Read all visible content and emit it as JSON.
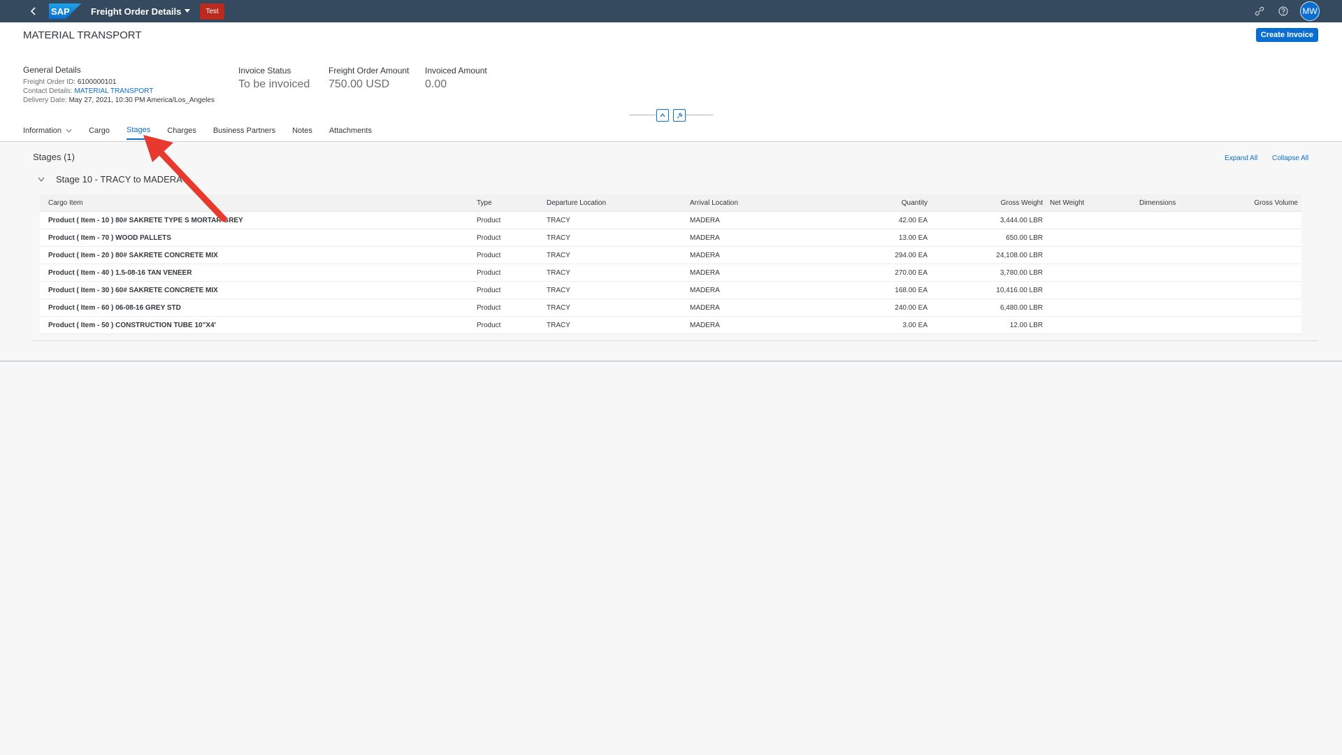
{
  "shell": {
    "app_title": "Freight Order Details",
    "env_badge": "Test",
    "logo_text": "SAP",
    "avatar_initials": "MW"
  },
  "header": {
    "title": "MATERIAL TRANSPORT",
    "create_invoice_label": "Create Invoice",
    "general": {
      "title": "General Details",
      "freight_order_id_label": "Freight Order ID:",
      "freight_order_id": "6100000101",
      "contact_label": "Contact Details:",
      "contact_value": "MATERIAL TRANSPORT",
      "delivery_label": "Delivery Date:",
      "delivery_value": "May 27, 2021, 10:30 PM America/Los_Angeles"
    },
    "kpis": [
      {
        "label": "Invoice Status",
        "value": "To be invoiced"
      },
      {
        "label": "Freight Order Amount",
        "value": "750.00 USD"
      },
      {
        "label": "Invoiced Amount",
        "value": "0.00"
      }
    ]
  },
  "tabs": [
    {
      "label": "Information"
    },
    {
      "label": "Cargo"
    },
    {
      "label": "Stages"
    },
    {
      "label": "Charges"
    },
    {
      "label": "Business Partners"
    },
    {
      "label": "Notes"
    },
    {
      "label": "Attachments"
    }
  ],
  "section": {
    "title": "Stages (1)",
    "expand_all": "Expand All",
    "collapse_all": "Collapse All",
    "stage_title": "Stage 10 - TRACY to MADERA"
  },
  "table": {
    "columns": [
      "Cargo Item",
      "Type",
      "Departure Location",
      "Arrival Location",
      "Quantity",
      "Gross Weight",
      "Net Weight",
      "Dimensions",
      "Gross Volume"
    ],
    "rows": [
      {
        "item": "Product ( Item - 10 ) 80# SAKRETE TYPE S MORTAR GREY",
        "type": "Product",
        "dep": "TRACY",
        "arr": "MADERA",
        "qty": "42.00 EA",
        "gw": "3,444.00 LBR"
      },
      {
        "item": "Product ( Item - 70 ) WOOD PALLETS",
        "type": "Product",
        "dep": "TRACY",
        "arr": "MADERA",
        "qty": "13.00 EA",
        "gw": "650.00 LBR"
      },
      {
        "item": "Product ( Item - 20 ) 80# SAKRETE CONCRETE MIX",
        "type": "Product",
        "dep": "TRACY",
        "arr": "MADERA",
        "qty": "294.00 EA",
        "gw": "24,108.00 LBR"
      },
      {
        "item": "Product ( Item - 40 ) 1.5-08-16 TAN VENEER",
        "type": "Product",
        "dep": "TRACY",
        "arr": "MADERA",
        "qty": "270.00 EA",
        "gw": "3,780.00 LBR"
      },
      {
        "item": "Product ( Item - 30 ) 60# SAKRETE CONCRETE MIX",
        "type": "Product",
        "dep": "TRACY",
        "arr": "MADERA",
        "qty": "168.00 EA",
        "gw": "10,416.00 LBR"
      },
      {
        "item": "Product ( Item - 60 ) 06-08-16 GREY STD",
        "type": "Product",
        "dep": "TRACY",
        "arr": "MADERA",
        "qty": "240.00 EA",
        "gw": "6,480.00 LBR"
      },
      {
        "item": "Product ( Item - 50 ) CONSTRUCTION TUBE 10\"X4'",
        "type": "Product",
        "dep": "TRACY",
        "arr": "MADERA",
        "qty": "3.00 EA",
        "gw": "12.00 LBR"
      }
    ]
  },
  "colors": {
    "shell_bg": "#354a5f",
    "accent": "#0a6ed1",
    "badge_red": "#bb2a1f",
    "annotation_arrow": "#e8392f"
  },
  "icons": {
    "back": "chevron-left-icon",
    "menu": "caret-down-icon",
    "share": "link-icon",
    "help": "help-icon",
    "collapse_header": "chevron-up-icon",
    "pin": "pin-icon",
    "stage_toggle": "chevron-down-icon",
    "annotation": "arrow-icon"
  }
}
